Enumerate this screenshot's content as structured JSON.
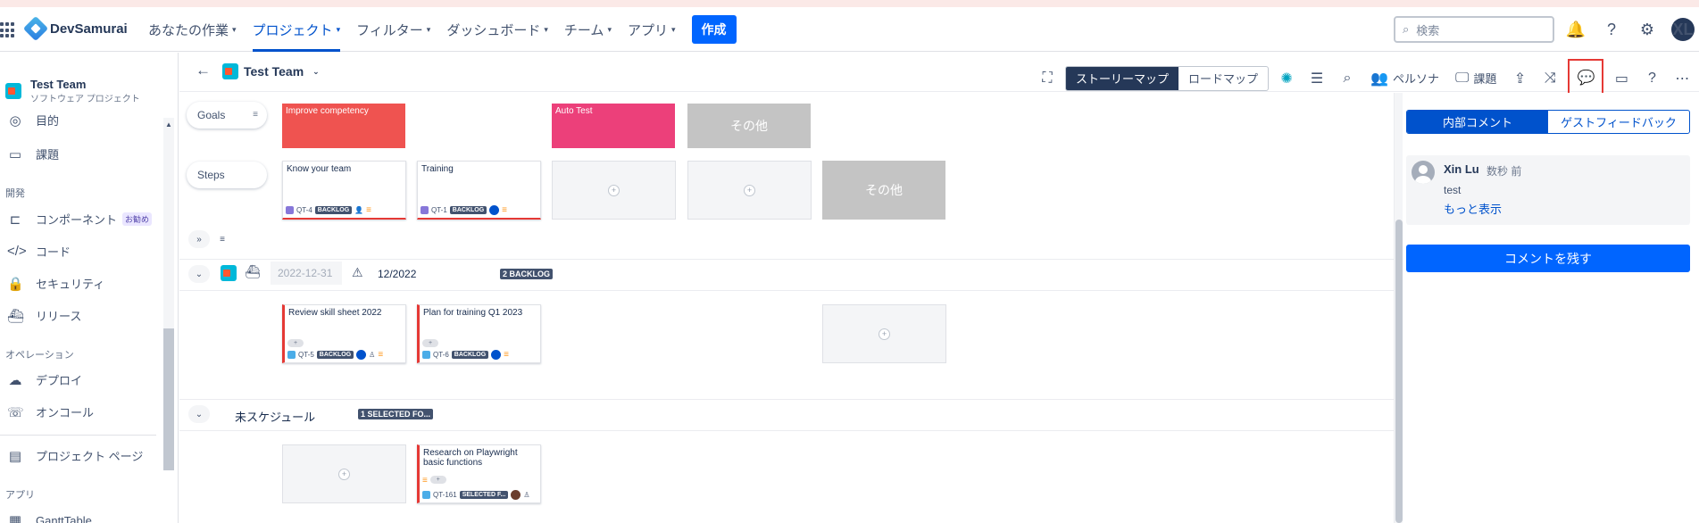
{
  "app": {
    "name": "DevSamurai"
  },
  "nav": {
    "items": [
      {
        "label": "あなたの作業"
      },
      {
        "label": "プロジェクト"
      },
      {
        "label": "フィルター"
      },
      {
        "label": "ダッシュボード"
      },
      {
        "label": "チーム"
      },
      {
        "label": "アプリ"
      }
    ],
    "create": "作成",
    "search_placeholder": "検索",
    "avatar": "XL"
  },
  "sidebar": {
    "project_name": "Test Team",
    "project_type": "ソフトウェア プロジェクト",
    "items": [
      {
        "label": "目的",
        "icon": "target-icon"
      },
      {
        "label": "課題",
        "icon": "issues-icon"
      },
      {
        "label": "コンポーネント",
        "icon": "component-icon",
        "badge": "お勧め"
      },
      {
        "label": "コード",
        "icon": "code-icon"
      },
      {
        "label": "セキュリティ",
        "icon": "lock-icon"
      },
      {
        "label": "リリース",
        "icon": "ship-icon"
      },
      {
        "label": "デプロイ",
        "icon": "cloud-upload-icon"
      },
      {
        "label": "オンコール",
        "icon": "phone-icon"
      },
      {
        "label": "プロジェクト ページ",
        "icon": "page-icon"
      },
      {
        "label": "GanttTable",
        "icon": "gantt-icon"
      }
    ],
    "sections": {
      "dev": "開発",
      "ops": "オペレーション",
      "apps": "アプリ"
    }
  },
  "toolbar": {
    "title": "Test Team",
    "story_map": "ストーリーマップ",
    "roadmap": "ロードマップ",
    "persona": "ペルソナ",
    "issues": "課題",
    "help": "?"
  },
  "board": {
    "goals_label": "Goals",
    "steps_label": "Steps",
    "goals": [
      {
        "title": "Improve competency",
        "color": "#ef5350"
      },
      {
        "title": "Auto Test",
        "color": "#ec407a"
      }
    ],
    "other": "その他",
    "steps": [
      {
        "title": "Know your team",
        "key": "QT-4",
        "status": "BACKLOG"
      },
      {
        "title": "Training",
        "key": "QT-1",
        "status": "BACKLOG"
      }
    ],
    "release": {
      "date": "2022-12-31",
      "name": "12/2022",
      "badge": "2 BACKLOG",
      "cards": [
        {
          "title": "Review skill sheet 2022",
          "key": "QT-5",
          "status": "BACKLOG"
        },
        {
          "title": "Plan for training Q1 2023",
          "key": "QT-6",
          "status": "BACKLOG"
        }
      ]
    },
    "unscheduled": {
      "name": "未スケジュール",
      "badge": "1 SELECTED FO...",
      "card": {
        "title": "Research on Playwright basic functions",
        "key": "QT-161",
        "status": "SELECTED F..."
      }
    }
  },
  "panel": {
    "tab_internal": "内部コメント",
    "tab_guest": "ゲストフィードバック",
    "comment": {
      "author": "Xin Lu",
      "time": "数秒 前",
      "text": "test",
      "more": "もっと表示"
    },
    "submit": "コメントを残す"
  }
}
